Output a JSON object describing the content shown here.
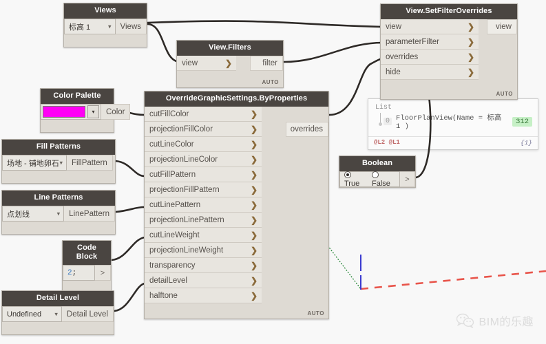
{
  "canvas": {
    "background": "#f8f8f8",
    "header_color": "#4a4541",
    "body_color": "#dedad3"
  },
  "nodes": {
    "views": {
      "title": "Views",
      "dropdown_value": "标高 1",
      "output_label": "Views"
    },
    "view_filters": {
      "title": "View.Filters",
      "input_label": "view",
      "output_label": "filter",
      "auto": "AUTO"
    },
    "set_filter_overrides": {
      "title": "View.SetFilterOverrides",
      "inputs": [
        "view",
        "parameterFilter",
        "overrides",
        "hide"
      ],
      "output_label": "view",
      "auto": "AUTO"
    },
    "color_palette": {
      "title": "Color Palette",
      "swatch_color": "#ff00f5",
      "output_label": "Color"
    },
    "fill_patterns": {
      "title": "Fill Patterns",
      "dropdown_value": "场地 - 铺地卵石",
      "output_label": "FillPattern"
    },
    "line_patterns": {
      "title": "Line Patterns",
      "dropdown_value": "点划线",
      "output_label": "LinePattern"
    },
    "code_block": {
      "title": "Code Block",
      "code_number": "2",
      "code_semicolon": ";",
      "output_label": ">"
    },
    "detail_level": {
      "title": "Detail Level",
      "dropdown_value": "Undefined",
      "output_label": "Detail Level"
    },
    "boolean": {
      "title": "Boolean",
      "true_label": "True",
      "false_label": "False",
      "selected": "True",
      "output_label": ">"
    },
    "override_graphic_settings": {
      "title": "OverrideGraphicSettings.ByProperties",
      "inputs": [
        "cutFillColor",
        "projectionFillColor",
        "cutLineColor",
        "projectionLineColor",
        "cutFillPattern",
        "projectionFillPattern",
        "cutLinePattern",
        "projectionLinePattern",
        "cutLineWeight",
        "projectionLineWeight",
        "transparency",
        "detailLevel",
        "halftone"
      ],
      "output_label": "overrides",
      "auto": "AUTO"
    }
  },
  "preview": {
    "list_label": "List",
    "index": "0",
    "value": "FloorPlanView(Name = 标高 1 )",
    "count_badge": "312",
    "levels": "@L2 @L1",
    "list_count": "{1}"
  },
  "watermark": {
    "text": "BIM的乐趣",
    "icon": "wechat-icon"
  },
  "geometry": {
    "green_line_color": "#2a8a3a",
    "red_dashed_color": "#e8544a",
    "blue_line_color": "#3a3ad0"
  }
}
